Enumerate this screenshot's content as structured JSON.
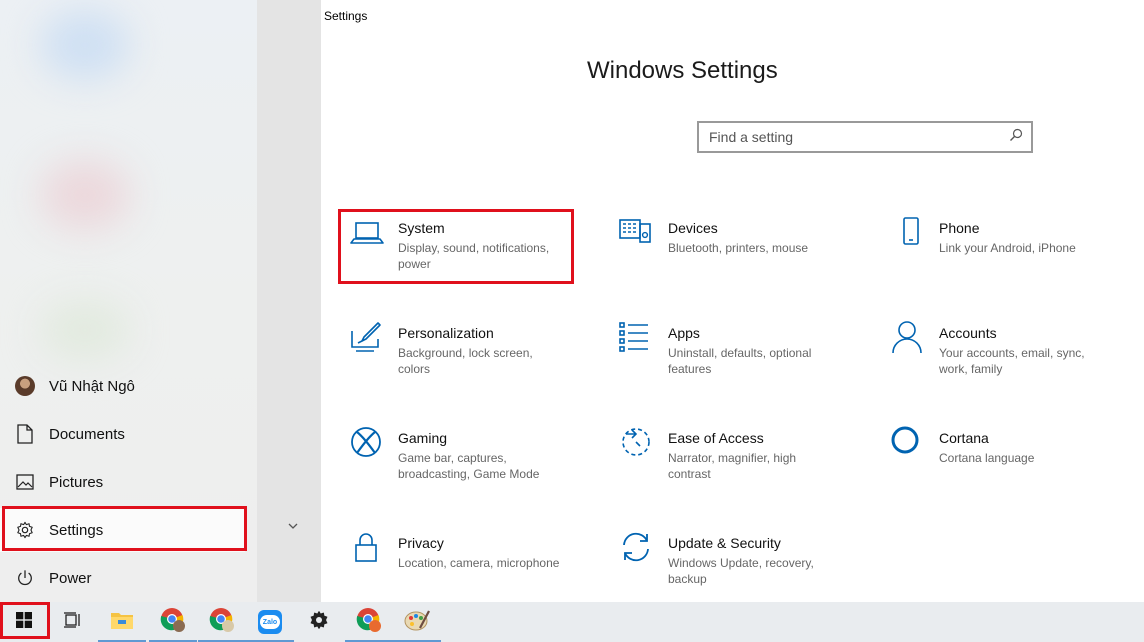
{
  "start_menu": {
    "user_name": "Vũ Nhật Ngô",
    "items": [
      {
        "label": "Documents",
        "icon": "document-icon"
      },
      {
        "label": "Pictures",
        "icon": "pictures-icon"
      },
      {
        "label": "Settings",
        "icon": "gear-icon"
      },
      {
        "label": "Power",
        "icon": "power-icon"
      }
    ]
  },
  "window": {
    "title": "Settings",
    "heading": "Windows Settings",
    "search": {
      "placeholder": "Find a setting",
      "value": ""
    }
  },
  "tiles": [
    {
      "title": "System",
      "desc": "Display, sound, notifications, power",
      "icon": "laptop-icon"
    },
    {
      "title": "Devices",
      "desc": "Bluetooth, printers, mouse",
      "icon": "devices-icon"
    },
    {
      "title": "Phone",
      "desc": "Link your Android, iPhone",
      "icon": "phone-icon"
    },
    {
      "title": "Personalization",
      "desc": "Background, lock screen, colors",
      "icon": "personalization-icon"
    },
    {
      "title": "Apps",
      "desc": "Uninstall, defaults, optional features",
      "icon": "apps-icon"
    },
    {
      "title": "Accounts",
      "desc": "Your accounts, email, sync, work, family",
      "icon": "person-icon"
    },
    {
      "title": "Gaming",
      "desc": "Game bar, captures, broadcasting, Game Mode",
      "icon": "xbox-icon"
    },
    {
      "title": "Ease of Access",
      "desc": "Narrator, magnifier, high contrast",
      "icon": "ease-of-access-icon"
    },
    {
      "title": "Cortana",
      "desc": "Cortana language",
      "icon": "cortana-icon"
    },
    {
      "title": "Privacy",
      "desc": "Location, camera, microphone",
      "icon": "lock-icon"
    },
    {
      "title": "Update & Security",
      "desc": "Windows Update, recovery, backup",
      "icon": "update-icon"
    }
  ],
  "taskbar": {
    "items": [
      "windows-start-icon",
      "task-view-icon",
      "file-explorer-icon",
      "chrome-icon",
      "chrome-icon",
      "zalo-icon",
      "gear-icon",
      "chrome-icon",
      "paint-icon"
    ],
    "zalo_label": "Zalo"
  },
  "colors": {
    "accent": "#0063b1",
    "highlight_border": "#e0101c",
    "taskbar": "#e9ecef"
  }
}
